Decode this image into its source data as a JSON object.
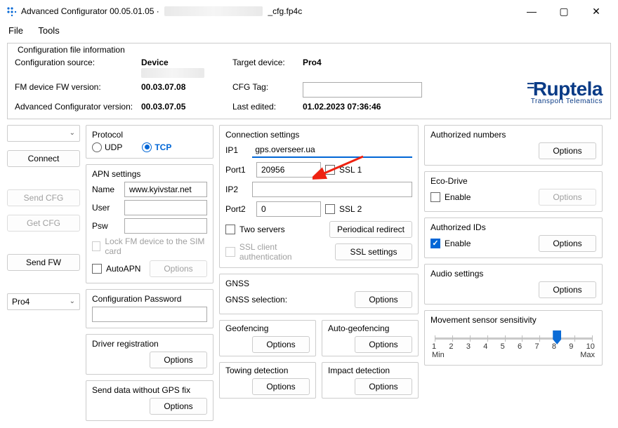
{
  "window": {
    "title_prefix": "Advanced Configurator 00.05.01.05 ·",
    "title_suffix": "_cfg.fp4c"
  },
  "menu": {
    "file": "File",
    "tools": "Tools"
  },
  "info": {
    "legend": "Configuration file information",
    "config_source_label": "Configuration source:",
    "config_source_value": "Device",
    "fm_fw_label": "FM device FW version:",
    "fm_fw_value": "00.03.07.08",
    "adv_ver_label": "Advanced Configurator version:",
    "adv_ver_value": "00.03.07.05",
    "target_label": "Target device:",
    "target_value": "Pro4",
    "cfg_tag_label": "CFG Tag:",
    "cfg_tag_value": "",
    "last_edited_label": "Last edited:",
    "last_edited_value": "01.02.2023 07:36:46"
  },
  "logo": {
    "brand": "Ruptela",
    "tagline": "Transport Telematics"
  },
  "left": {
    "connect": "Connect",
    "send_cfg": "Send CFG",
    "get_cfg": "Get CFG",
    "send_fw": "Send FW",
    "device_select": "Pro4"
  },
  "protocol": {
    "title": "Protocol",
    "udp": "UDP",
    "tcp": "TCP",
    "selected": "tcp"
  },
  "apn": {
    "title": "APN settings",
    "name_label": "Name",
    "name_value": "www.kyivstar.net",
    "user_label": "User",
    "user_value": "",
    "psw_label": "Psw",
    "psw_value": "",
    "lock_sim": "Lock FM device to the SIM card",
    "auto_apn": "AutoAPN",
    "options": "Options"
  },
  "config_pw": {
    "title": "Configuration Password",
    "value": ""
  },
  "driver_reg": {
    "title": "Driver registration",
    "options": "Options"
  },
  "send_no_gps": {
    "title": "Send data without GPS fix",
    "options": "Options"
  },
  "conn": {
    "title": "Connection settings",
    "ip1_label": "IP1",
    "ip1_value": "gps.overseer.ua",
    "port1_label": "Port1",
    "port1_value": "20956",
    "ssl1": "SSL 1",
    "ip2_label": "IP2",
    "ip2_value": "",
    "port2_label": "Port2",
    "port2_value": "0",
    "ssl2": "SSL 2",
    "two_servers": "Two servers",
    "periodical": "Periodical redirect",
    "ssl_auth": "SSL client authentication",
    "ssl_settings": "SSL settings"
  },
  "gnss": {
    "title": "GNSS",
    "selection": "GNSS selection:",
    "options": "Options"
  },
  "geofencing": {
    "title": "Geofencing",
    "options": "Options"
  },
  "auto_geo": {
    "title": "Auto-geofencing",
    "options": "Options"
  },
  "towing": {
    "title": "Towing detection",
    "options": "Options"
  },
  "impact": {
    "title": "Impact detection",
    "options": "Options"
  },
  "auth_numbers": {
    "title": "Authorized numbers",
    "options": "Options"
  },
  "eco": {
    "title": "Eco-Drive",
    "enable": "Enable",
    "options": "Options"
  },
  "auth_ids": {
    "title": "Authorized IDs",
    "enable": "Enable",
    "options": "Options",
    "enabled": true
  },
  "audio": {
    "title": "Audio settings",
    "options": "Options"
  },
  "sensitivity": {
    "title": "Movement sensor sensitivity",
    "ticks": [
      "1",
      "2",
      "3",
      "4",
      "5",
      "6",
      "7",
      "8",
      "9",
      "10"
    ],
    "min": "Min",
    "max": "Max",
    "value": 8
  }
}
